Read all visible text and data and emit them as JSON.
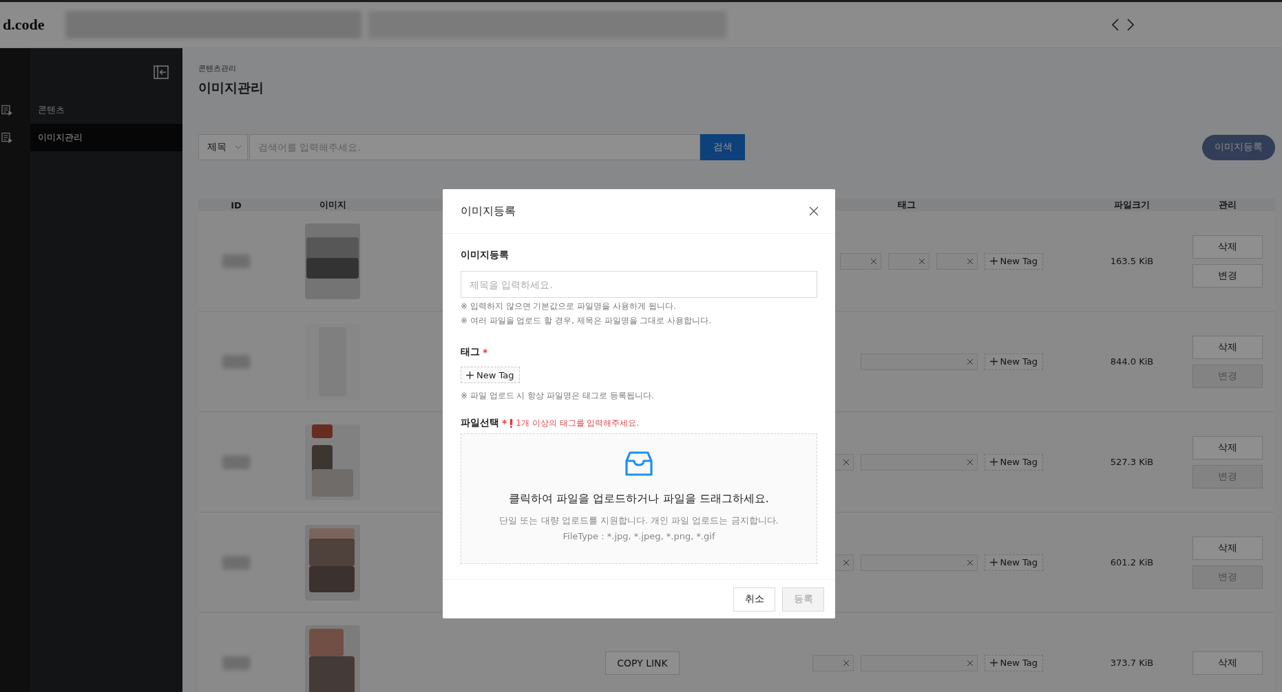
{
  "header": {
    "logo": "d.code"
  },
  "sidebar": {
    "items": [
      {
        "label": "콘텐츠",
        "selected": false
      },
      {
        "label": "이미지관리",
        "selected": true
      }
    ]
  },
  "page": {
    "breadcrumb": "콘텐츠관리",
    "title": "이미지관리"
  },
  "search": {
    "field": "제목",
    "placeholder": "검색어를 입력해주세요.",
    "button": "검색"
  },
  "register_button": "이미지등록",
  "table": {
    "columns": [
      "ID",
      "이미지",
      "태그",
      "파일크기",
      "관리"
    ],
    "rows": [
      {
        "image": {
          "kind": "picture"
        },
        "tags": [
          {
            "kind": "short"
          },
          {
            "kind": "short"
          },
          {
            "kind": "short"
          }
        ],
        "new_tag": "New Tag",
        "size": "163.5 KiB",
        "delete": "삭제",
        "change": {
          "label": "변경",
          "disabled": false
        }
      },
      {
        "image": {
          "kind": "picture"
        },
        "tags": [
          {
            "kind": "long"
          }
        ],
        "new_tag": "New Tag",
        "size": "844.0 KiB",
        "delete": "삭제",
        "change": {
          "label": "변경",
          "disabled": true
        }
      },
      {
        "image": {
          "kind": "picture"
        },
        "tags": [
          {
            "kind": "short"
          },
          {
            "kind": "long"
          }
        ],
        "new_tag": "New Tag",
        "size": "527.3 KiB",
        "delete": "삭제",
        "change": {
          "label": "변경",
          "disabled": true
        }
      },
      {
        "image": {
          "kind": "picture"
        },
        "tags": [
          {
            "kind": "short"
          },
          {
            "kind": "long"
          }
        ],
        "new_tag": "New Tag",
        "size": "601.2 KiB",
        "delete": "삭제",
        "change": {
          "label": "변경",
          "disabled": true
        }
      },
      {
        "image": {
          "kind": "picture"
        },
        "copy_link": "COPY LINK",
        "tags": [
          {
            "kind": "short"
          },
          {
            "kind": "long"
          }
        ],
        "new_tag": "New Tag",
        "size": "373.7 KiB",
        "delete": "삭제"
      }
    ]
  },
  "modal": {
    "title": "이미지등록",
    "title_field": {
      "label": "이미지등록",
      "placeholder": "제목을 입력하세요.",
      "hints": [
        "※ 입력하지 않으면 기본값으로 파일명을 사용하게 됩니다.",
        "※ 여러 파일을 업로드 할 경우, 제목은 파일명을 그대로 사용합니다."
      ]
    },
    "tags": {
      "label": "태그",
      "required_mark": "*",
      "new_tag": "New Tag",
      "hints": [
        "※ 파일 업로드 시 항상 파일명은 태그로 등록됩니다."
      ]
    },
    "file": {
      "label": "파일선택",
      "required_mark": "*",
      "error": "1개 이상의 태그를 입력해주세요.",
      "dropzone": {
        "title": "클릭하여 파일을 업로드하거나 파일을 드래그하세요.",
        "lines": [
          "단일 또는 대량 업로드를 지원합니다. 개인 파일 업로드는 금지합니다.",
          "FileType : *.jpg, *.jpeg, *.png, *.gif"
        ]
      }
    },
    "buttons": [
      {
        "label": "취소",
        "disabled": false
      },
      {
        "label": "등록",
        "disabled": true
      }
    ]
  }
}
